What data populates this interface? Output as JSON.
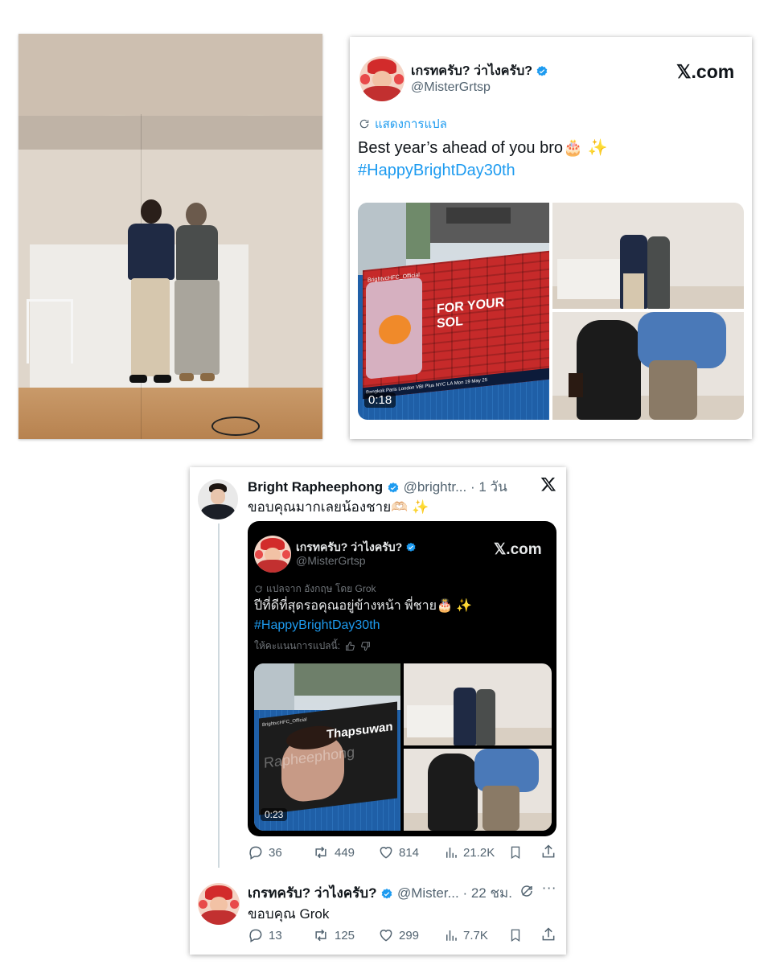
{
  "tweet": {
    "author_name": "เกรทครับ? ว่าไงครับ?",
    "author_handle": "@MisterGrtsp",
    "site_badge": "𝕏.com",
    "translate_label": "แสดงการแปล",
    "text": "Best year’s ahead of you bro🎂 ✨",
    "hashtag": "#HappyBrightDay30th",
    "video_duration": "0:18",
    "billboard_text_line1": "FOR YOUR",
    "billboard_text_line2": "SOL",
    "billboard_account": "BrightvcHFC_Official",
    "ticker_text": "Bangkok  Paris  London  VBI Plus  NYC  LA  Mon 19 May 25"
  },
  "reply": {
    "author_name": "Bright Rapheephong",
    "author_handle": "@brightr...",
    "time_ago": "· 1 วัน",
    "text": "ขอบคุณมากเลยน้องชาย🫶🏻 ✨",
    "quoted": {
      "author_name": "เกรทครับ? ว่าไงครับ?",
      "author_handle": "@MisterGrtsp",
      "site_badge": "𝕏.com",
      "translated_label": "แปลจาก อังกฤษ โดย Grok",
      "text": "ปีที่ดีที่สุดรอคุณอยู่ข้างหน้า พี่ชาย🎂 ✨",
      "hashtag": "#HappyBrightDay30th",
      "rate_label": "ให้คะแนนการแปลนี้:",
      "video_duration": "0:23",
      "billboard_name1": "Thapsuwan",
      "billboard_name2": "Rapheephong",
      "billboard_account": "BrightvcHFC_Official"
    },
    "stats": {
      "replies": "36",
      "reposts": "449",
      "likes": "814",
      "views": "21.2K"
    }
  },
  "second_reply": {
    "author_name": "เกรทครับ? ว่าไงครับ?",
    "author_handle": "@Mister...",
    "time_ago": "· 22 ชม.",
    "text": "ขอบคุณ Grok",
    "stats": {
      "replies": "13",
      "reposts": "125",
      "likes": "299",
      "views": "7.7K"
    }
  },
  "colors": {
    "accent": "#1d9bf0",
    "verified": "#1d9bf0",
    "muted": "#536471",
    "billboard_red": "#c62a2a"
  }
}
